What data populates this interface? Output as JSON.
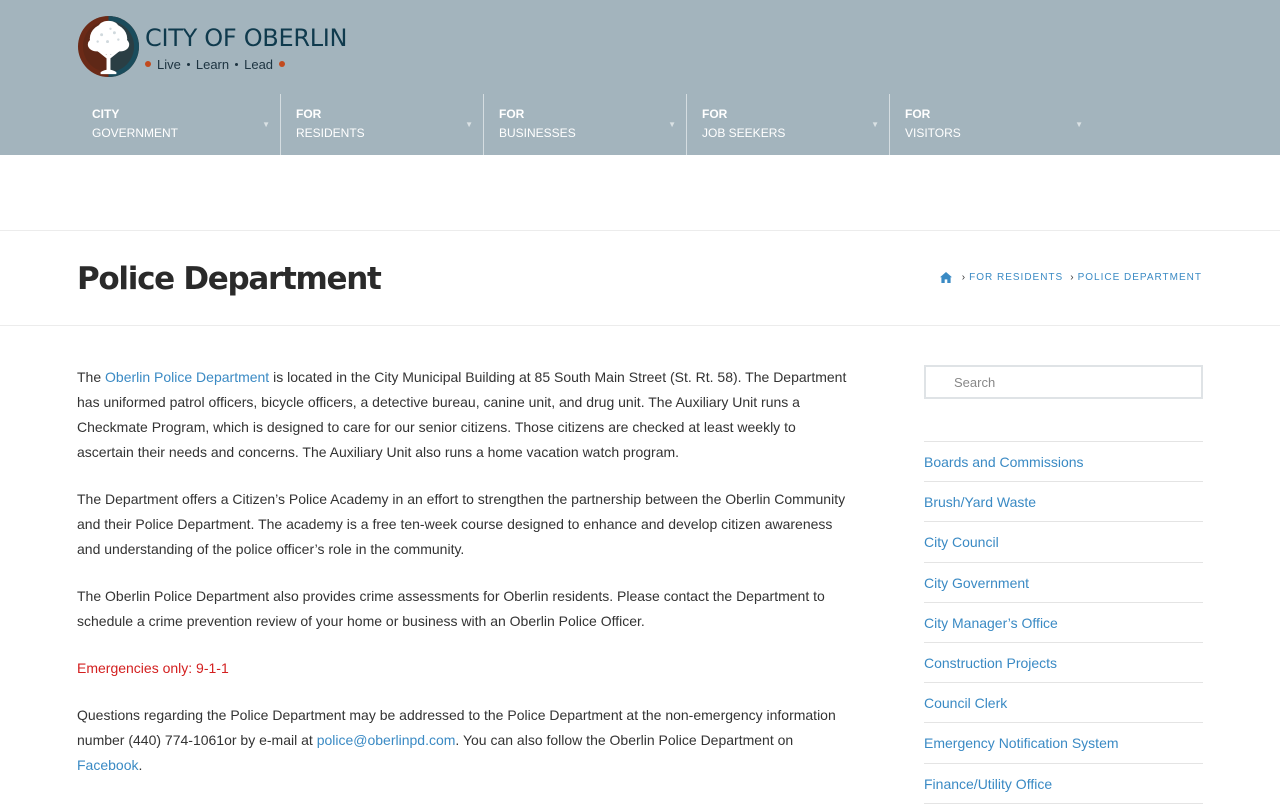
{
  "logo": {
    "title": "CITY OF OBERLIN",
    "tagline": [
      "Live",
      "Learn",
      "Lead"
    ]
  },
  "nav": [
    {
      "top": "CITY",
      "bottom": "GOVERNMENT"
    },
    {
      "top": "FOR",
      "bottom": "RESIDENTS"
    },
    {
      "top": "FOR",
      "bottom": "BUSINESSES"
    },
    {
      "top": "FOR",
      "bottom": "JOB SEEKERS"
    },
    {
      "top": "FOR",
      "bottom": "VISITORS"
    }
  ],
  "page": {
    "title": "Police Department"
  },
  "breadcrumb": {
    "icon": "home-icon",
    "items": [
      "FOR RESIDENTS",
      "POLICE DEPARTMENT"
    ]
  },
  "content": {
    "p1": {
      "before": "The ",
      "link": "Oberlin Police Department",
      "after": " is located in the City Municipal Building at 85 South Main Street (St. Rt. 58). The Department has uniformed patrol officers, bicycle officers, a detective bureau, canine unit, and drug unit. The Auxiliary Unit runs a Checkmate Program, which is designed to care for our senior citizens. Those citizens are checked at least weekly to ascertain their needs and concerns. The Auxiliary Unit also runs a home vacation watch program."
    },
    "p2": "The Department offers a Citizen’s Police Academy in an effort to strengthen the partnership between the Oberlin Community and their Police Department. The academy is a free ten-week course designed to enhance and develop citizen awareness and understanding of the police officer’s role in the community.",
    "p3": "The Oberlin Police Department also provides crime assessments for Oberlin residents. Please contact the Department to schedule a crime prevention review of your home or business with an Oberlin Police Officer.",
    "emergency": "Emergencies only: 9-1-1",
    "p5": {
      "before": "Questions regarding the Police Department may be addressed to the Police Department at the non-emergency information number (440) 774-1061or by e-mail at ",
      "email": "police@oberlinpd.com",
      "middle": ". You can also follow the Oberlin Police Department on ",
      "facebook": "Facebook",
      "after": "."
    }
  },
  "sidebar": {
    "search_placeholder": "Search",
    "items": [
      "Boards and Commissions",
      "Brush/Yard Waste",
      "City Council",
      "City Government",
      "City Manager’s Office",
      "Construction Projects",
      "Council Clerk",
      "Emergency Notification System",
      "Finance/Utility Office"
    ]
  },
  "colors": {
    "header": "#a3b4bd",
    "link": "#3a8ac4",
    "emergency": "#d31f1f",
    "logo_text": "#0f3a4d",
    "logo_dot": "#c24a1e"
  }
}
